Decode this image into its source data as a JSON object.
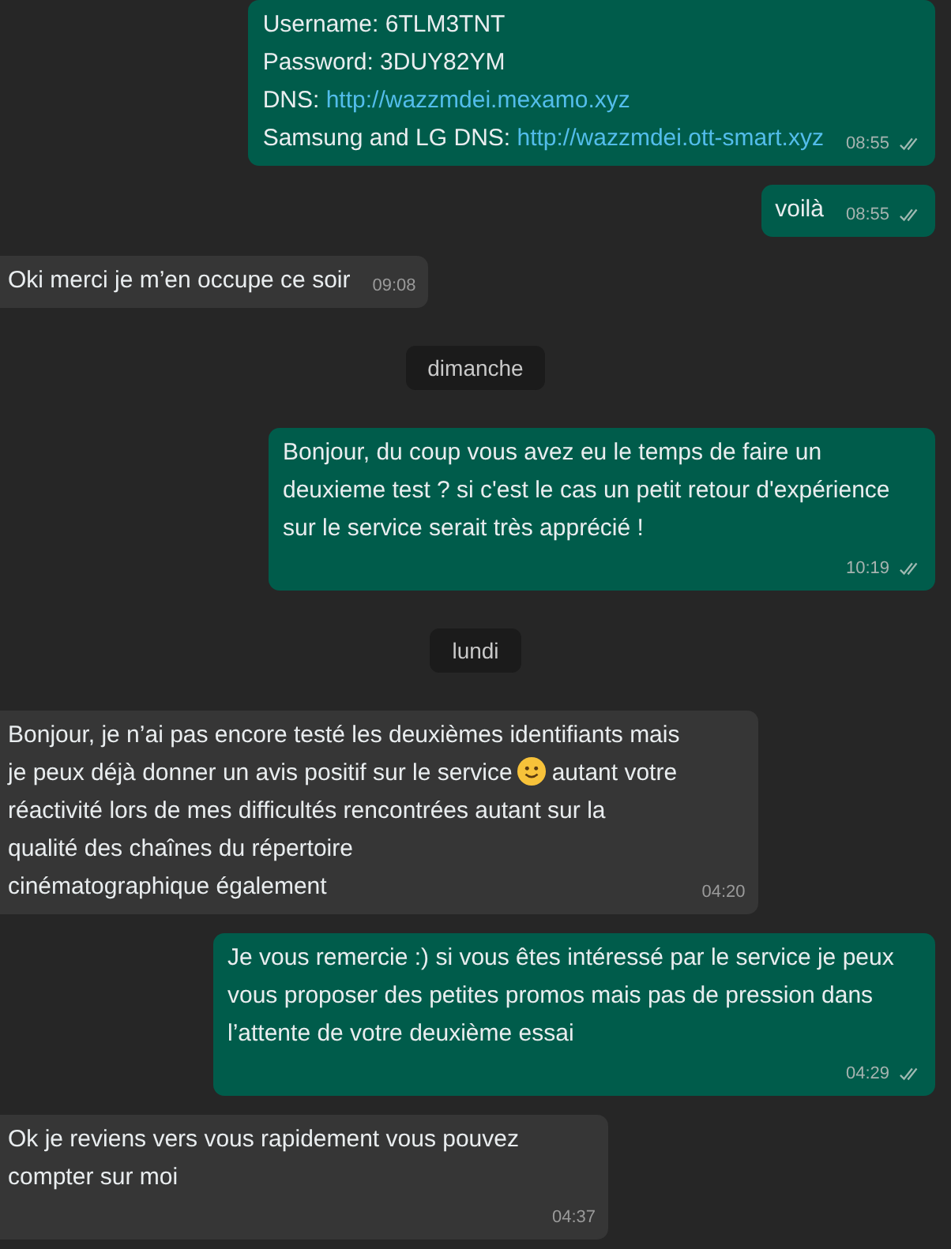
{
  "messages": [
    {
      "kind": "message",
      "outgoing": true,
      "lines": [
        {
          "label": "Username: 6TLM3TNT"
        },
        {
          "label": "Password: 3DUY82YM"
        },
        {
          "label": "DNS: ",
          "link": "http://wazzmdei.mexamo.xyz"
        },
        {
          "label": "Samsung and LG DNS: ",
          "link": "http://wazzmdei.ott-smart.xyz"
        }
      ],
      "time": "08:55",
      "read": true
    },
    {
      "kind": "message",
      "outgoing": true,
      "lines": [
        {
          "label": "voilà"
        }
      ],
      "time": "08:55",
      "read": true
    },
    {
      "kind": "message",
      "outgoing": false,
      "lines": [
        {
          "label": "Oki merci je m’en occupe ce soir"
        }
      ],
      "time": "09:08"
    },
    {
      "kind": "date",
      "label": "dimanche"
    },
    {
      "kind": "message",
      "outgoing": true,
      "lines": [
        {
          "label": "Bonjour, du coup vous avez eu le temps de faire un deuxieme test ? si c'est le cas un petit retour d'expérience sur le service serait très apprécié !"
        }
      ],
      "time": "10:19",
      "read": true
    },
    {
      "kind": "date",
      "label": "lundi"
    },
    {
      "kind": "message",
      "outgoing": false,
      "lines": [
        {
          "label": "Bonjour, je n’ai pas encore testé les deuxièmes identifiants mais"
        },
        {
          "label": "je peux déjà donner un avis positif sur le service",
          "emoji": true,
          "after": "autant votre"
        },
        {
          "label": "réactivité lors de mes difficultés rencontrées autant sur la"
        },
        {
          "label": "qualité des chaînes du répertoire"
        },
        {
          "label": "cinématographique également"
        }
      ],
      "time": "04:20"
    },
    {
      "kind": "message",
      "outgoing": true,
      "lines": [
        {
          "label": "Je vous remercie :) si vous êtes intéressé par le service je peux vous proposer des petites promos mais pas de pression dans l’attente de votre deuxième essai"
        }
      ],
      "time": "04:29",
      "read": true
    },
    {
      "kind": "message",
      "outgoing": false,
      "lines": [
        {
          "label": "Ok je reviens vers vous rapidement vous pouvez compter sur moi"
        }
      ],
      "time": "04:37"
    }
  ]
}
